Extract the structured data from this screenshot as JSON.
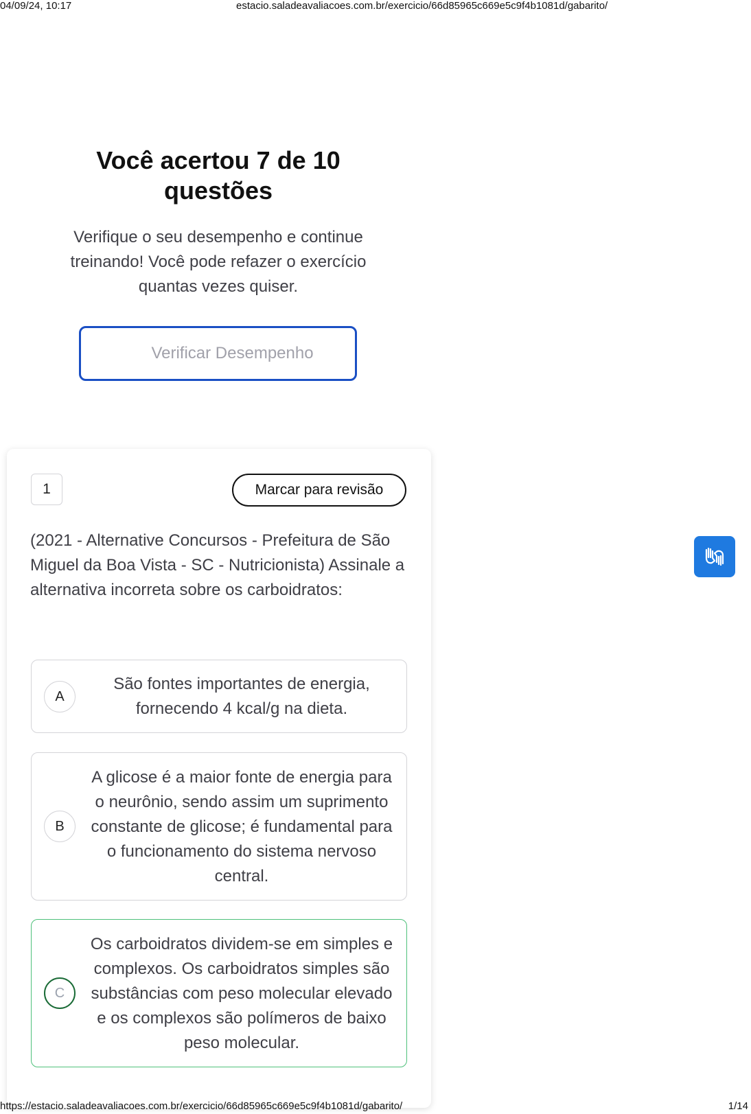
{
  "print": {
    "date": "04/09/24, 10:17",
    "header_url": "estacio.saladeavaliacoes.com.br/exercicio/66d85965c669e5c9f4b1081d/gabarito/",
    "footer_url": "https://estacio.saladeavaliacoes.com.br/exercicio/66d85965c669e5c9f4b1081d/gabarito/",
    "page": "1/14"
  },
  "result": {
    "title": "Você acertou 7 de 10 questões",
    "subtitle": "Verifique o seu desempenho e continue treinando! Você pode refazer o exercício quantas vezes quiser.",
    "verify_button": "Verificar Desempenho"
  },
  "question": {
    "number": "1",
    "mark_review": "Marcar para revisão",
    "text": "(2021 - Alternative Concursos - Prefeitura de São Miguel da Boa Vista - SC - Nutricionista) Assinale a alternativa incorreta sobre os carboidratos:",
    "options": [
      {
        "letter": "A",
        "text": "São fontes importantes de energia, fornecendo 4 kcal/g na dieta."
      },
      {
        "letter": "B",
        "text": "A glicose é a maior fonte de energia para o neurônio, sendo assim um suprimento constante de glicose; é fundamental para o funcionamento do sistema nervoso central."
      },
      {
        "letter": "C",
        "text": "Os carboidratos dividem-se em simples e complexos. Os carboidratos simples são substâncias com peso molecular elevado e os complexos são polímeros de baixo peso molecular."
      }
    ]
  },
  "accessibility": {
    "icon": "sign-language-hands-icon",
    "color": "#1f7ae0"
  },
  "colors": {
    "primary_border": "#1a4fc4",
    "correct_border": "#4ec07a",
    "correct_circle": "#1a6b36"
  }
}
